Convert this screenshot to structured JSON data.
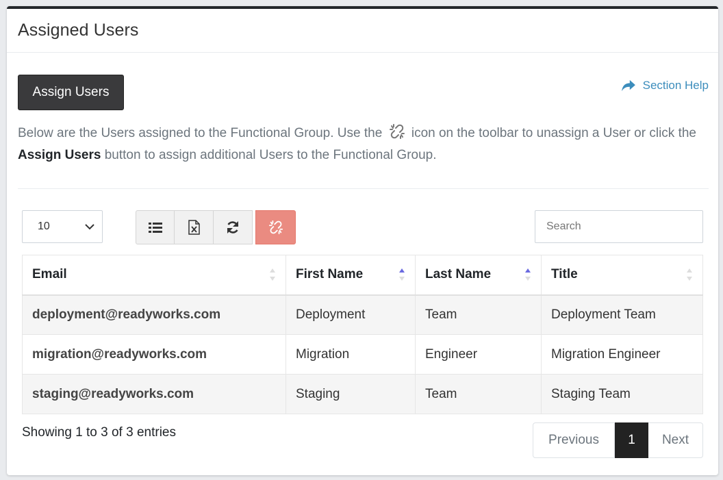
{
  "card": {
    "title": "Assigned Users"
  },
  "actions": {
    "assign_label": "Assign Users",
    "help_label": "Section Help"
  },
  "description": {
    "part1": "Below are the Users assigned to the Functional Group. Use the",
    "part2": "icon on the toolbar to unassign a User or click the",
    "bold": "Assign Users",
    "part3": "button to assign additional Users to the Functional Group."
  },
  "controls": {
    "page_size": "10",
    "search_placeholder": "Search",
    "toolbar_icons": [
      "list-icon",
      "excel-export-icon",
      "refresh-icon",
      "unlink-icon"
    ]
  },
  "table": {
    "columns": [
      "Email",
      "First Name",
      "Last Name",
      "Title"
    ],
    "rows": [
      [
        "deployment@readyworks.com",
        "Deployment",
        "Team",
        "Deployment Team"
      ],
      [
        "migration@readyworks.com",
        "Migration",
        "Engineer",
        "Migration Engineer"
      ],
      [
        "staging@readyworks.com",
        "Staging",
        "Team",
        "Staging Team"
      ]
    ]
  },
  "footer": {
    "info": "Showing 1 to 3 of 3 entries",
    "prev": "Previous",
    "page": "1",
    "next": "Next"
  },
  "colors": {
    "header_bar": "#23272b",
    "link": "#3c8dbc",
    "unlink_button": "#ea8b81",
    "sort_active": "#6a6ae0"
  }
}
